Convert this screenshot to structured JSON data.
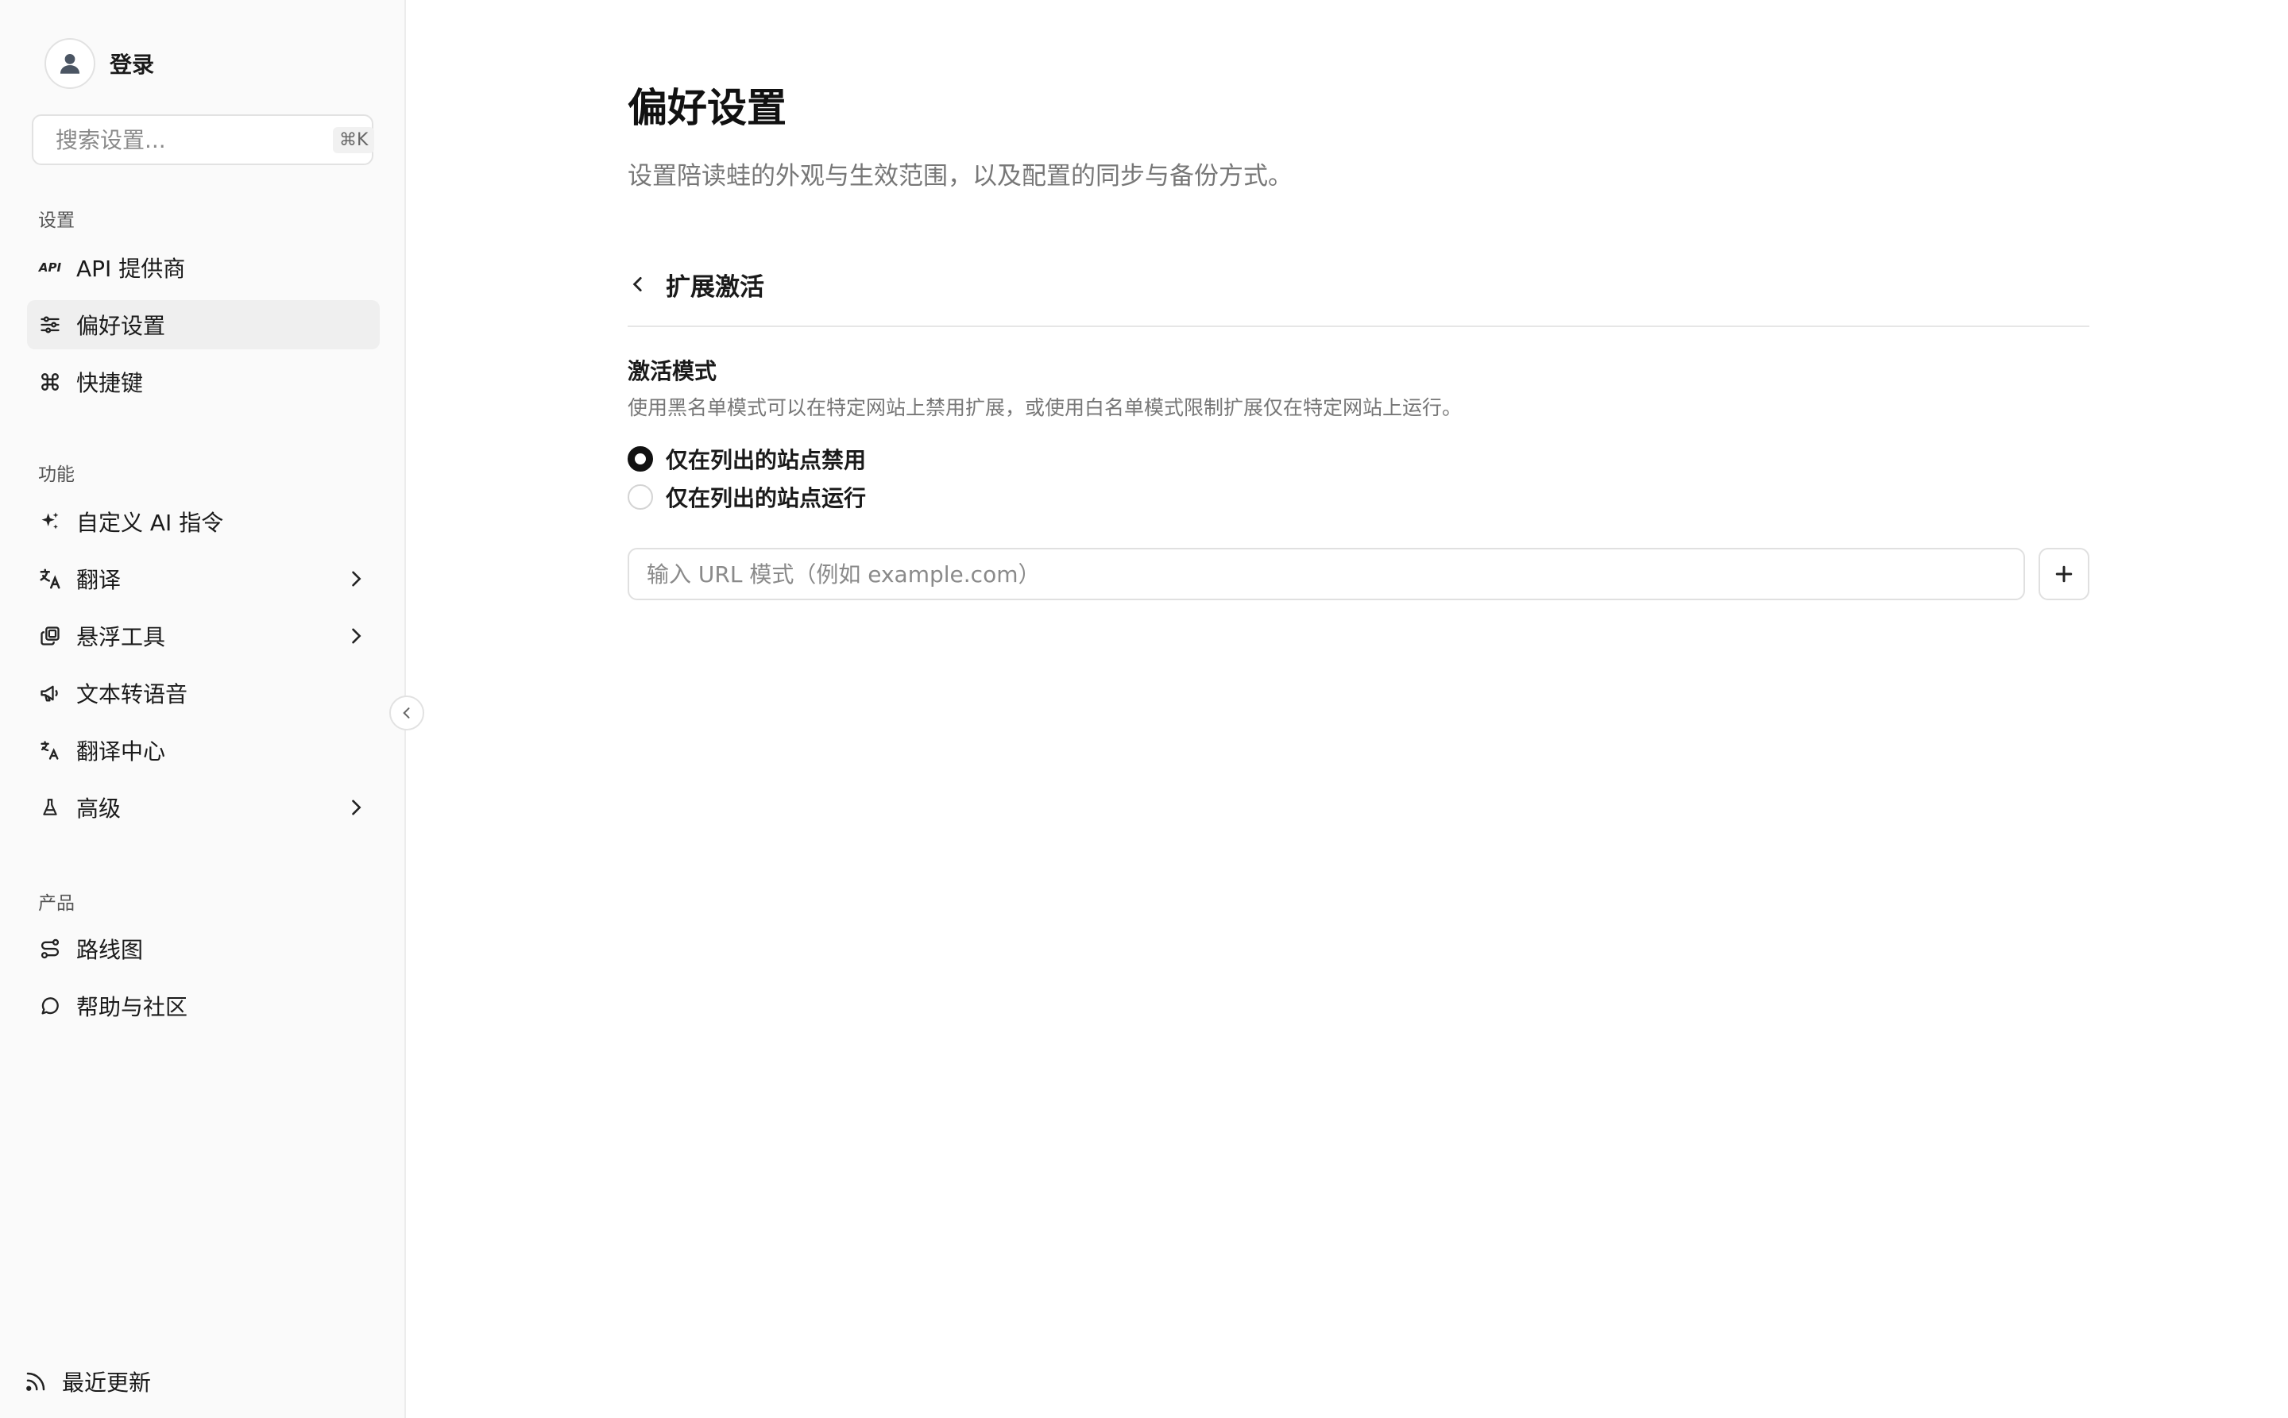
{
  "sidebar": {
    "user_label": "登录",
    "search": {
      "placeholder": "搜索设置...",
      "shortcut": "⌘K"
    },
    "sections": {
      "settings": "设置",
      "features": "功能",
      "product": "产品"
    },
    "items": {
      "api": "API 提供商",
      "preferences": "偏好设置",
      "shortcuts": "快捷键",
      "custom_ai": "自定义 AI 指令",
      "translate": "翻译",
      "floating_tools": "悬浮工具",
      "tts": "文本转语音",
      "translation_hub": "翻译中心",
      "advanced": "高级",
      "roadmap": "路线图",
      "help": "帮助与社区"
    },
    "recent_updates": "最近更新",
    "active_item": "偏好设置",
    "api_icon_text": "API"
  },
  "main": {
    "title": "偏好设置",
    "subtitle": "设置陪读蛙的外观与生效范围，以及配置的同步与备份方式。",
    "section_title": "扩展激活",
    "field": {
      "title": "激活模式",
      "description": "使用黑名单模式可以在特定网站上禁用扩展，或使用白名单模式限制扩展仅在特定网站上运行。",
      "options": [
        {
          "label": "仅在列出的站点禁用",
          "checked": true
        },
        {
          "label": "仅在列出的站点运行",
          "checked": false
        }
      ],
      "url_placeholder": "输入 URL 模式（例如 example.com）",
      "url_value": ""
    }
  },
  "icons": {
    "avatar": "user-icon",
    "search": "search-icon",
    "api": "api-icon",
    "preferences": "sliders-icon",
    "shortcuts": "command-icon",
    "custom_ai": "sparkles-icon",
    "translate": "translate-icon",
    "floating_tools": "layers-icon",
    "tts": "megaphone-icon",
    "translation_hub": "language-icon",
    "advanced": "flask-icon",
    "roadmap": "route-icon",
    "help": "message-circle-icon",
    "recent": "rss-icon",
    "collapse": "chevron-left-icon",
    "back": "chevron-left-icon",
    "add": "plus-icon"
  },
  "colors": {
    "accent": "#111111",
    "sidebar_bg": "#fafafa",
    "active_bg": "#efefef"
  }
}
